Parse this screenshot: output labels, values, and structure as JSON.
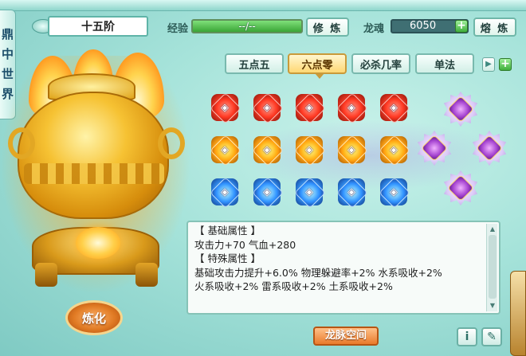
{
  "side_tab": {
    "chars": [
      "鼎",
      "中",
      "世",
      "界"
    ]
  },
  "header": {
    "title": "十五阶",
    "exp_label": "经验",
    "exp_value": "--/--",
    "cultivate_button": "修 炼",
    "soul_label": "龙魂",
    "soul_value": "6050",
    "smelt_button": "熔 炼"
  },
  "tabs": [
    {
      "label": "五点五",
      "active": false
    },
    {
      "label": "六点零",
      "active": true
    },
    {
      "label": "必杀几率",
      "active": false
    },
    {
      "label": "单法",
      "active": false
    }
  ],
  "gems": {
    "rows": [
      {
        "color": "red",
        "count": 5
      },
      {
        "color": "orange",
        "count": 5
      },
      {
        "color": "blue",
        "count": 5
      }
    ],
    "star_slots": 4
  },
  "attributes": {
    "lines": [
      "【 基础属性 】",
      "攻击力+70  气血+280",
      "【 特殊属性 】",
      "基础攻击力提升+6.0%  物理躲避率+2%  水系吸收+2%",
      "火系吸收+2%  雷系吸收+2%  土系吸收+2%"
    ]
  },
  "refine_button": "炼化",
  "space_button": "龙脉空间",
  "colors": {
    "accent": "#e97a2b",
    "panel_border": "#86c3b7",
    "active_tab": "#ffd874"
  }
}
